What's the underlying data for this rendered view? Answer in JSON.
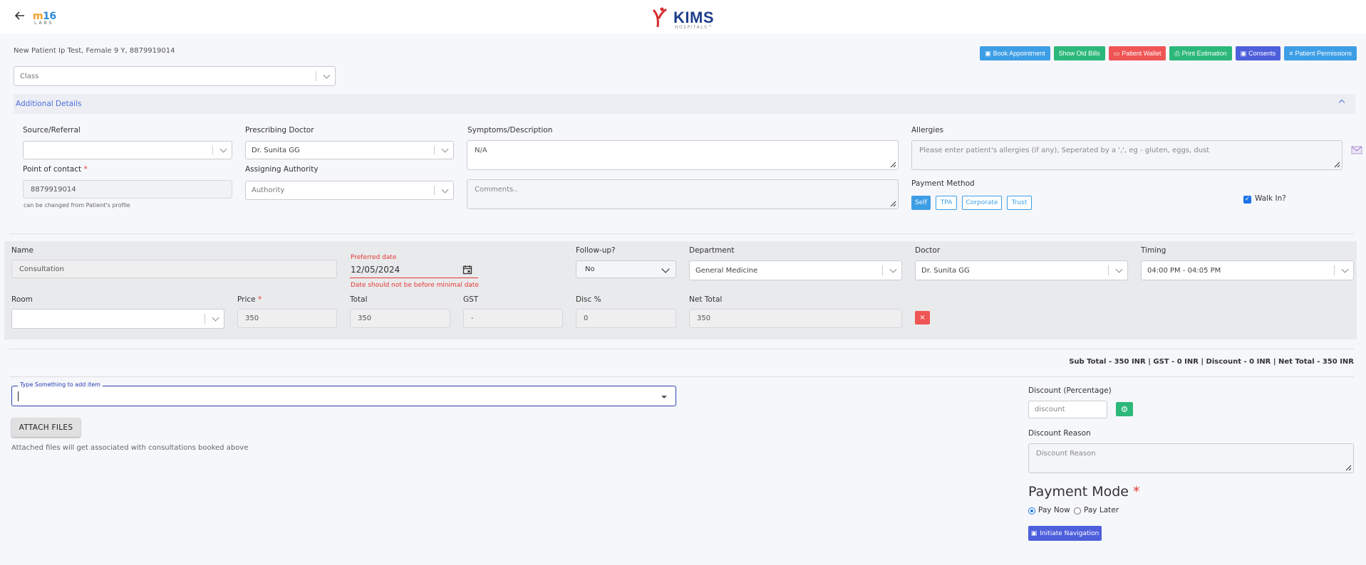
{
  "header": {
    "brand_left_big": "m16",
    "brand_left_small": "LABS",
    "brand_center": "KIMS",
    "brand_center_sub": "HOSPITALS™"
  },
  "patient": {
    "info": "New Patient Ip Test, Female 9 Y, 8879919014"
  },
  "actions": {
    "book_appointment": "Book Appointment",
    "show_old_bills": "Show Old Bills",
    "patient_wallet": "Patient Wallet",
    "print_estimation": "Print Estimation",
    "consents": "Consents",
    "patient_permissions": "Patient Permissions"
  },
  "class_select": {
    "placeholder": "Class"
  },
  "additional": {
    "title": "Additional Details",
    "source_label": "Source/Referral",
    "source_value": "",
    "prescribing_label": "Prescribing Doctor",
    "prescribing_value": "Dr. Sunita GG",
    "symptoms_label": "Symptoms/Description",
    "symptoms_value": "N/A",
    "allergies_label": "Allergies",
    "allergies_placeholder": "Please enter patient's allergies (if any), Seperated by a ',', eg - gluten, eggs, dust",
    "poc_label": "Point of contact",
    "poc_value": "8879919014",
    "poc_hint": "can be changed from Patient's profile",
    "authority_label": "Assigning Authority",
    "authority_placeholder": "Authority",
    "comments_placeholder": "Comments..",
    "payment_method_label": "Payment Method",
    "payment_methods": [
      "Self",
      "TPA",
      "Corporate",
      "Trust"
    ],
    "walk_in_label": "Walk In?"
  },
  "item": {
    "name_label": "Name",
    "name_value": "Consultation",
    "preferred_date_label": "Preferred date",
    "preferred_date_value": "12/05/2024",
    "date_error": "Date should not be before minimal date",
    "followup_label": "Follow-up?",
    "followup_value": "No",
    "department_label": "Department",
    "department_value": "General Medicine",
    "doctor_label": "Doctor",
    "doctor_value": "Dr. Sunita GG",
    "timing_label": "Timing",
    "timing_value": "04:00 PM - 04:05 PM",
    "room_label": "Room",
    "room_value": "",
    "price_label": "Price",
    "price_value": "350",
    "total_label": "Total",
    "total_value": "350",
    "gst_label": "GST",
    "gst_value": "-",
    "disc_label": "Disc %",
    "disc_value": "0",
    "net_label": "Net Total",
    "net_value": "350",
    "delete_symbol": "×"
  },
  "summary": {
    "text": "Sub Total - 350 INR | GST - 0 INR | Discount - 0 INR | Net Total - 350 INR"
  },
  "add_item": {
    "legend": "Type Something to add item"
  },
  "attach": {
    "button": "ATTACH FILES",
    "hint": "Attached files will get associated with consultations booked above"
  },
  "discount": {
    "pct_label": "Discount (Percentage)",
    "pct_placeholder": "discount",
    "reason_label": "Discount Reason",
    "reason_placeholder": "Discount Reason"
  },
  "payment_mode": {
    "title": "Payment Mode",
    "pay_now": "Pay Now",
    "pay_later": "Pay Later",
    "initiate": "Initiate Navigation"
  },
  "colors": {
    "blue": "#3d9ee6",
    "green": "#2cb87a",
    "red": "#ef5555",
    "indigo": "#4e5fdc"
  }
}
